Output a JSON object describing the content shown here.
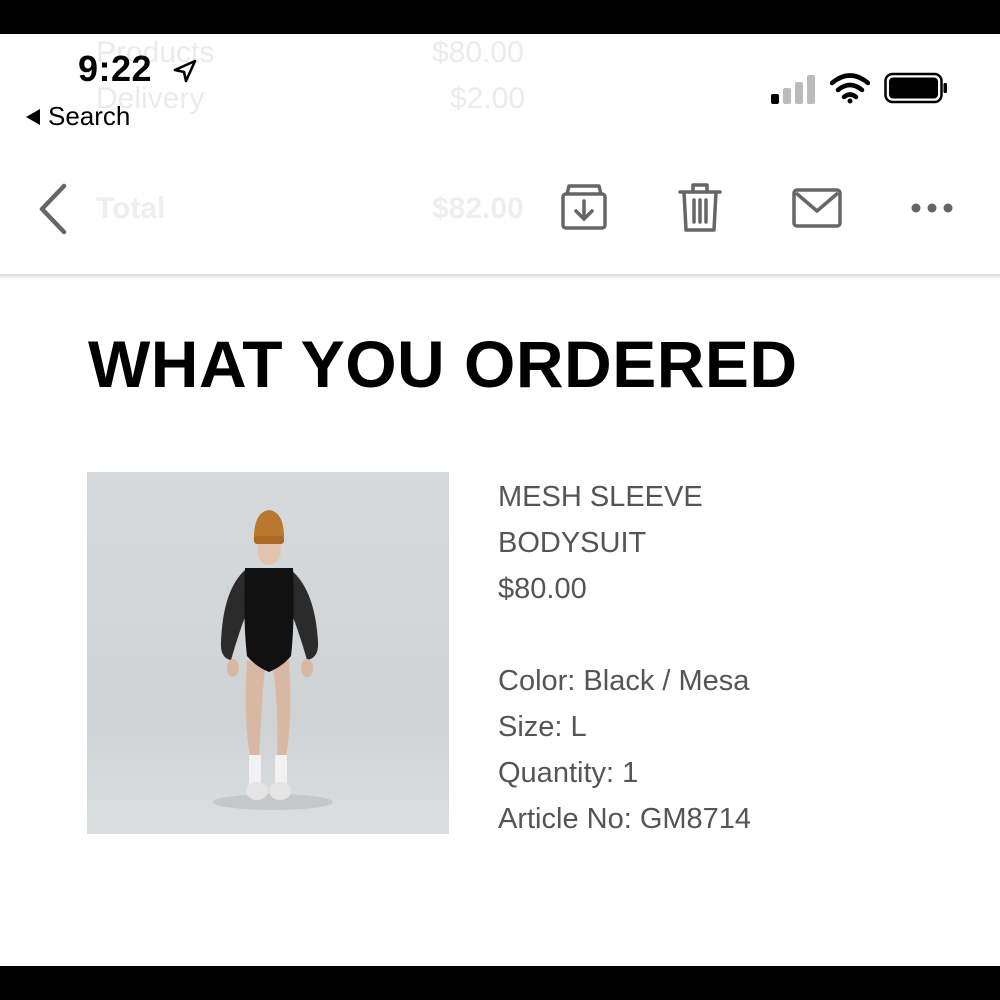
{
  "ghost_summary": {
    "products_label": "Products",
    "products_value": "$80.00",
    "delivery_label": "Delivery",
    "delivery_value": "$2.00",
    "total_label": "Total",
    "total_value": "$82.00"
  },
  "status_bar": {
    "time": "9:22",
    "back_app_label": "Search"
  },
  "toolbar": {
    "icons": [
      "back-chevron-icon",
      "archive-icon",
      "trash-icon",
      "mail-icon",
      "more-icon"
    ]
  },
  "order": {
    "heading": "WHAT YOU ORDERED",
    "product_name_line1": "MESH SLEEVE",
    "product_name_line2": "BODYSUIT",
    "price": "$80.00",
    "color": "Color: Black / Mesa",
    "size": "Size: L",
    "quantity": "Quantity: 1",
    "article": "Article No: GM8714"
  },
  "colors": {
    "text_primary": "#000000",
    "text_secondary": "#555555",
    "icon_gray": "#666666"
  }
}
